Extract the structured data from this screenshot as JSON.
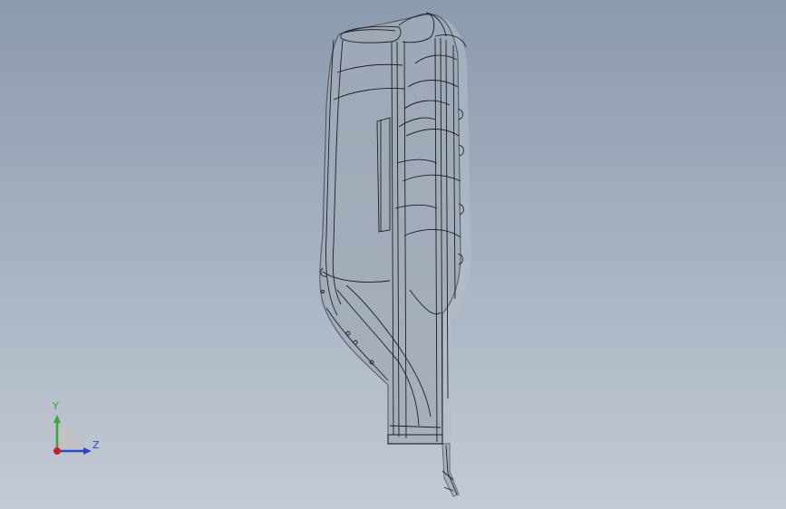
{
  "viewport": {
    "background_top": "#8c9aae",
    "background_bottom": "#c3cad4",
    "model": {
      "wire_color": "#1c1f26",
      "fill_color": "#9aa3b1",
      "shadow_color": "#b7bdc6"
    }
  },
  "triad": {
    "y_label": "Y",
    "z_label": "Z",
    "y_color": "#3aa43a",
    "z_color": "#2b46c9",
    "origin_color": "#c8202a",
    "icon": "orientation-triad-icon"
  }
}
